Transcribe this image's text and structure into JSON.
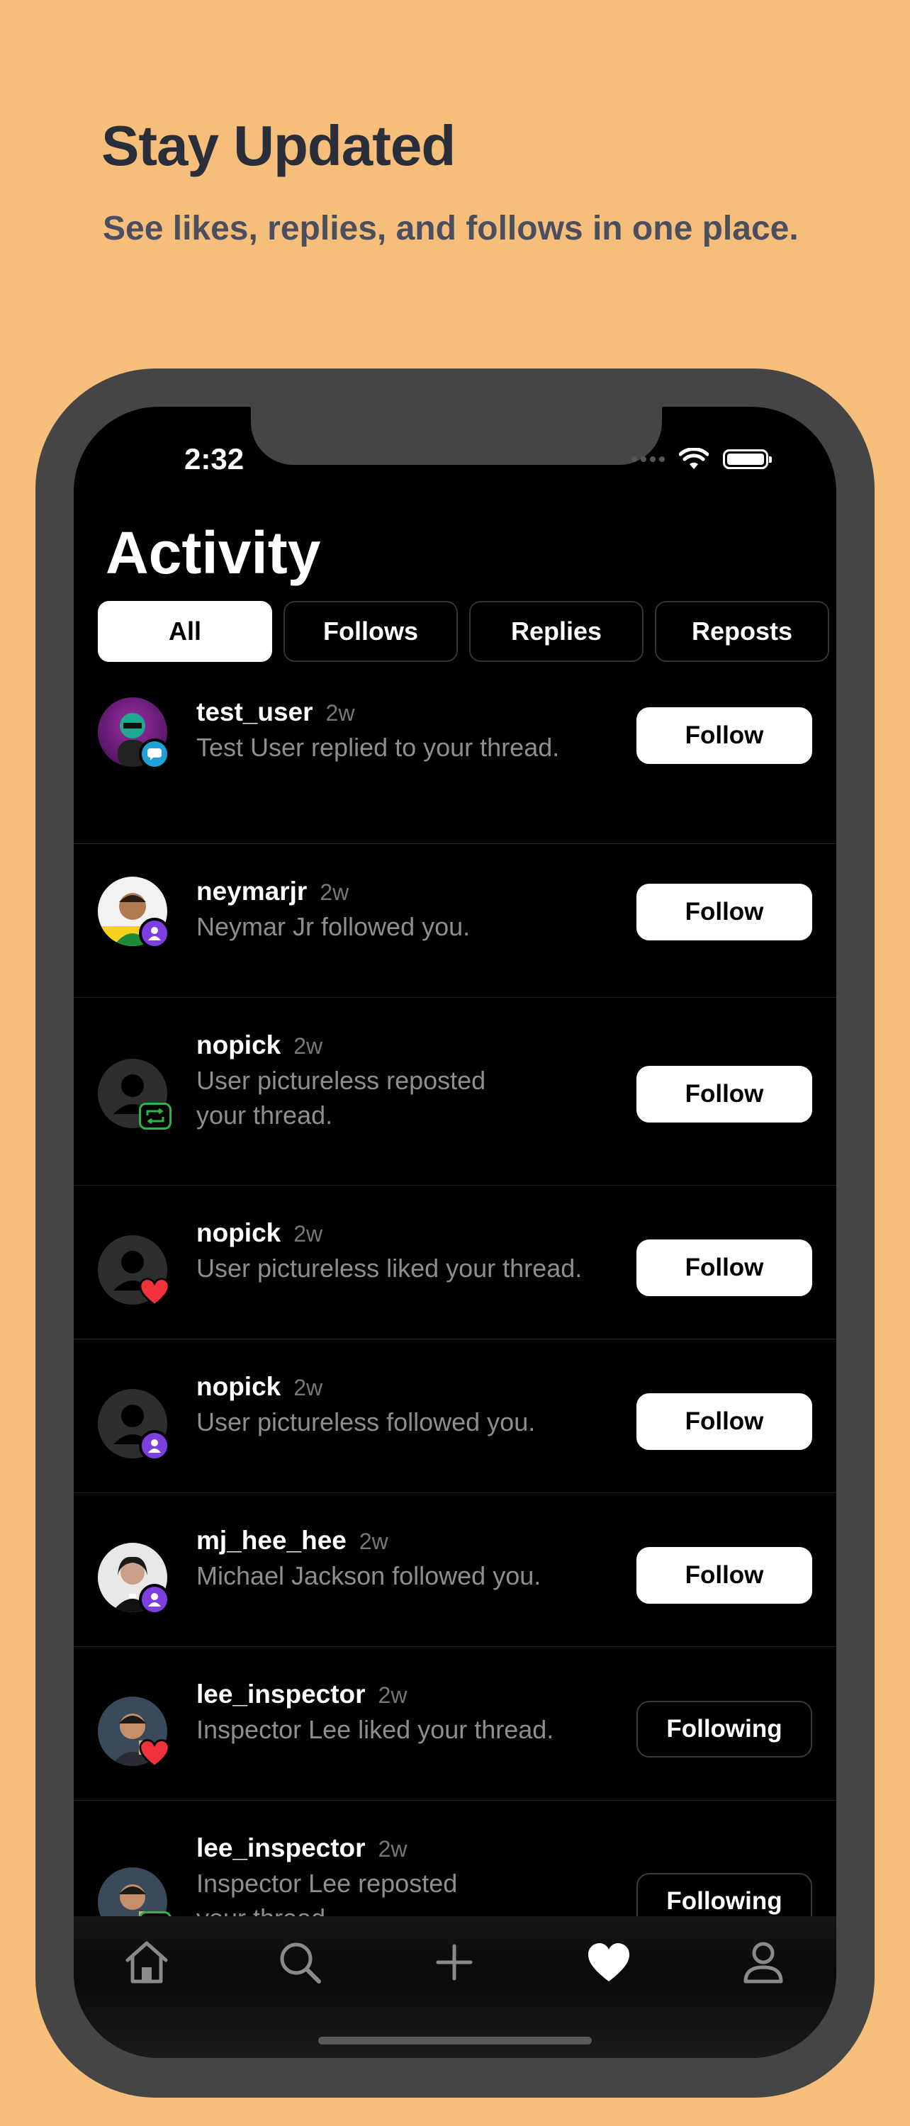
{
  "promo": {
    "title": "Stay Updated",
    "subtitle": "See likes, replies, and follows in one place."
  },
  "status_bar": {
    "time": "2:32"
  },
  "page_title": "Activity",
  "tabs": [
    {
      "label": "All",
      "active": true
    },
    {
      "label": "Follows",
      "active": false
    },
    {
      "label": "Replies",
      "active": false
    },
    {
      "label": "Reposts",
      "active": false
    }
  ],
  "activities": [
    {
      "username": "test_user",
      "time": "2w",
      "text": "Test User replied to your thread.",
      "badge": "reply-icon",
      "action": "Follow"
    },
    {
      "username": "neymarjr",
      "time": "2w",
      "text": "Neymar Jr followed you.",
      "badge": "follow-icon",
      "action": "Follow"
    },
    {
      "username": "nopick",
      "time": "2w",
      "text": "User pictureless reposted your thread.",
      "badge": "repost-icon",
      "action": "Follow"
    },
    {
      "username": "nopick",
      "time": "2w",
      "text": "User pictureless liked your thread.",
      "badge": "heart-icon",
      "action": "Follow"
    },
    {
      "username": "nopick",
      "time": "2w",
      "text": "User pictureless followed you.",
      "badge": "follow-icon",
      "action": "Follow"
    },
    {
      "username": "mj_hee_hee",
      "time": "2w",
      "text": "Michael Jackson followed you.",
      "badge": "follow-icon",
      "action": "Follow"
    },
    {
      "username": "lee_inspector",
      "time": "2w",
      "text": "Inspector Lee liked your thread.",
      "badge": "heart-icon",
      "action": "Following"
    },
    {
      "username": "lee_inspector",
      "time": "2w",
      "text": "Inspector Lee reposted your thread.",
      "badge": "repost-icon",
      "action": "Following"
    }
  ],
  "tab_bar": [
    "home-icon",
    "search-icon",
    "plus-icon",
    "heart-icon",
    "profile-icon"
  ],
  "colors": {
    "background": "#F5BE7B",
    "reply": "#1DA1D6",
    "follow": "#7E3FE0",
    "like": "#F0323C",
    "repost": "#2BB54A"
  }
}
